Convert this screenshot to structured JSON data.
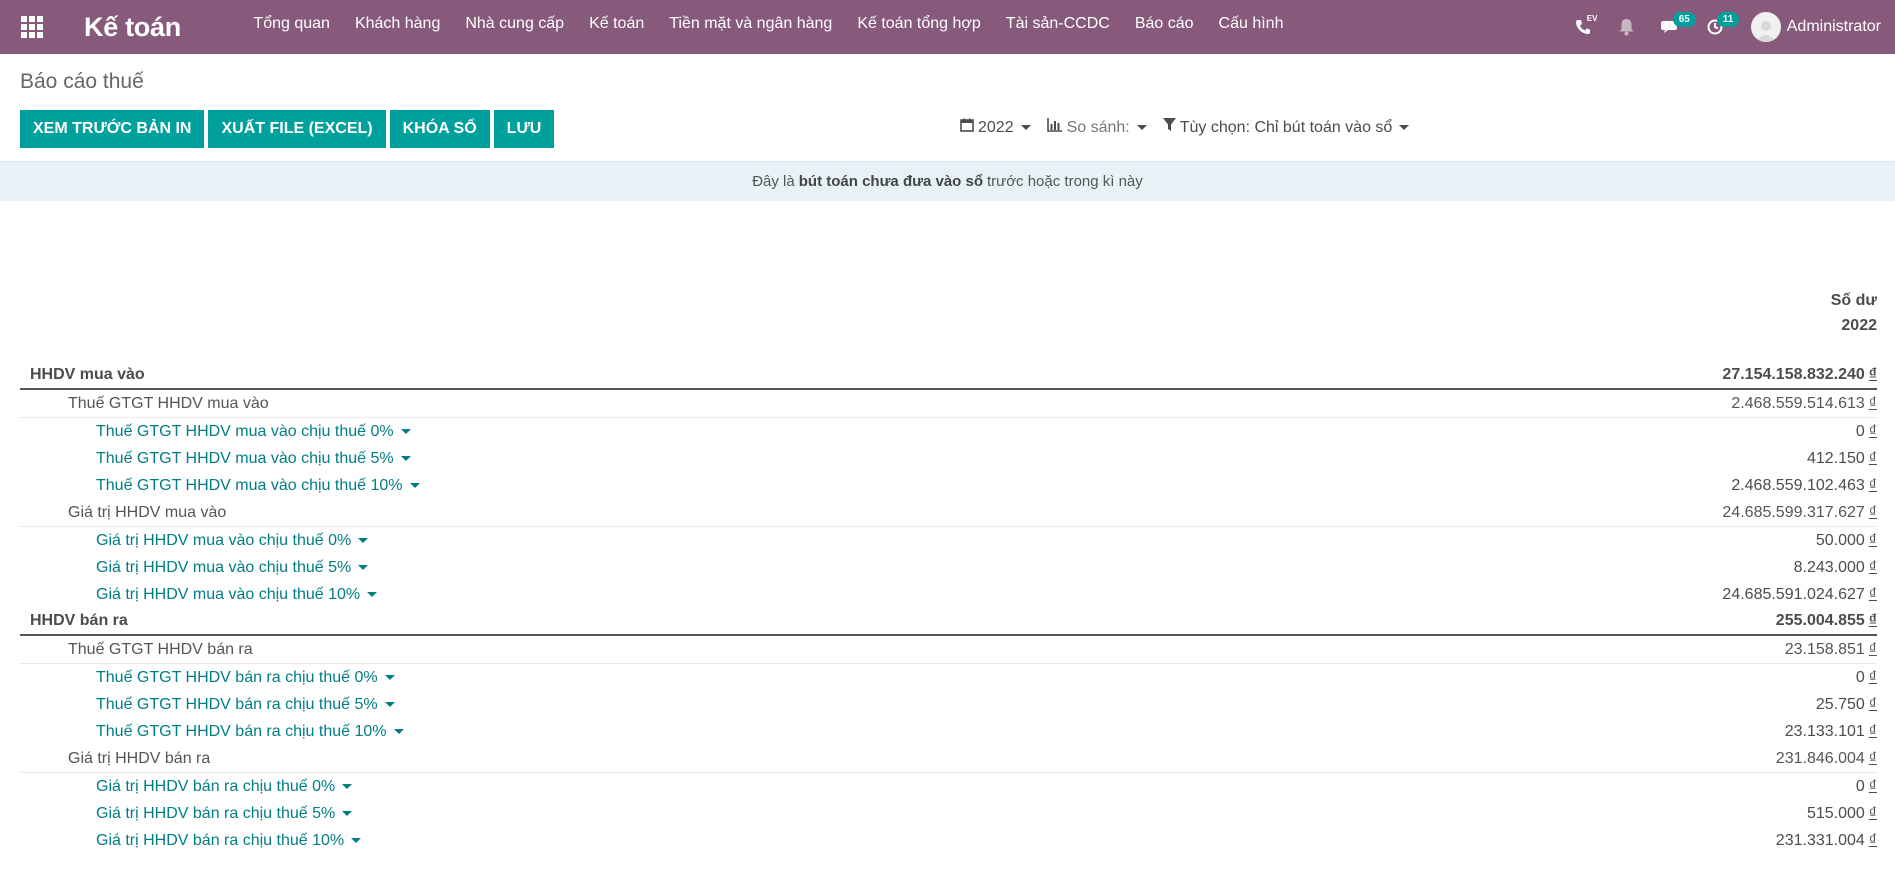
{
  "navbar": {
    "brand": "Kế toán",
    "menu": [
      "Tổng quan",
      "Khách hàng",
      "Nhà cung cấp",
      "Kế toán",
      "Tiền mặt và ngân hàng",
      "Kế toán tổng hợp",
      "Tài sản-CCDC",
      "Báo cáo",
      "Cấu hình"
    ],
    "ev_label": "EV",
    "messages_count": "65",
    "activities_count": "11",
    "user": "Administrator",
    "bg_color": "#875a7b"
  },
  "page": {
    "title": "Báo cáo thuế",
    "buttons": [
      "XEM TRƯỚC BẢN IN",
      "XUẤT FILE (EXCEL)",
      "KHÓA SỔ",
      "LƯU"
    ],
    "filters": {
      "period": "2022",
      "compare": "So sánh:",
      "options": "Tùy chọn: Chỉ bút toán vào sổ"
    },
    "notice": {
      "prefix": "Đây là",
      "bold": "bút toán chưa đưa vào sổ",
      "suffix": "trước hoặc trong kì này"
    },
    "accent_color": "#00a09d"
  },
  "report": {
    "column_header_1": "Số dư",
    "column_header_2": "2022",
    "currency": "₫",
    "rows": [
      {
        "level": 0,
        "label": "HHDV mua vào",
        "value": "27.154.158.832.240"
      },
      {
        "level": 1,
        "label": "Thuế GTGT HHDV mua vào",
        "value": "2.468.559.514.613"
      },
      {
        "level": 2,
        "label": "Thuế GTGT HHDV mua vào chịu thuế 0%",
        "value": "0"
      },
      {
        "level": 2,
        "label": "Thuế GTGT HHDV mua vào chịu thuế 5%",
        "value": "412.150"
      },
      {
        "level": 2,
        "label": "Thuế GTGT HHDV mua vào chịu thuế 10%",
        "value": "2.468.559.102.463"
      },
      {
        "level": 1,
        "label": "Giá trị HHDV mua vào",
        "value": "24.685.599.317.627"
      },
      {
        "level": 2,
        "label": "Giá trị HHDV mua vào chịu thuế 0%",
        "value": "50.000"
      },
      {
        "level": 2,
        "label": "Giá trị HHDV mua vào chịu thuế 5%",
        "value": "8.243.000"
      },
      {
        "level": 2,
        "label": "Giá trị HHDV mua vào chịu thuế 10%",
        "value": "24.685.591.024.627"
      },
      {
        "level": 0,
        "label": "HHDV bán ra",
        "value": "255.004.855"
      },
      {
        "level": 1,
        "label": "Thuế GTGT HHDV bán ra",
        "value": "23.158.851"
      },
      {
        "level": 2,
        "label": "Thuế GTGT HHDV bán ra chịu thuế 0%",
        "value": "0"
      },
      {
        "level": 2,
        "label": "Thuế GTGT HHDV bán ra chịu thuế 5%",
        "value": "25.750"
      },
      {
        "level": 2,
        "label": "Thuế GTGT HHDV bán ra chịu thuế 10%",
        "value": "23.133.101"
      },
      {
        "level": 1,
        "label": "Giá trị HHDV bán ra",
        "value": "231.846.004"
      },
      {
        "level": 2,
        "label": "Giá trị HHDV bán ra chịu thuế 0%",
        "value": "0"
      },
      {
        "level": 2,
        "label": "Giá trị HHDV bán ra chịu thuế 5%",
        "value": "515.000"
      },
      {
        "level": 2,
        "label": "Giá trị HHDV bán ra chịu thuế 10%",
        "value": "231.331.004"
      }
    ]
  }
}
